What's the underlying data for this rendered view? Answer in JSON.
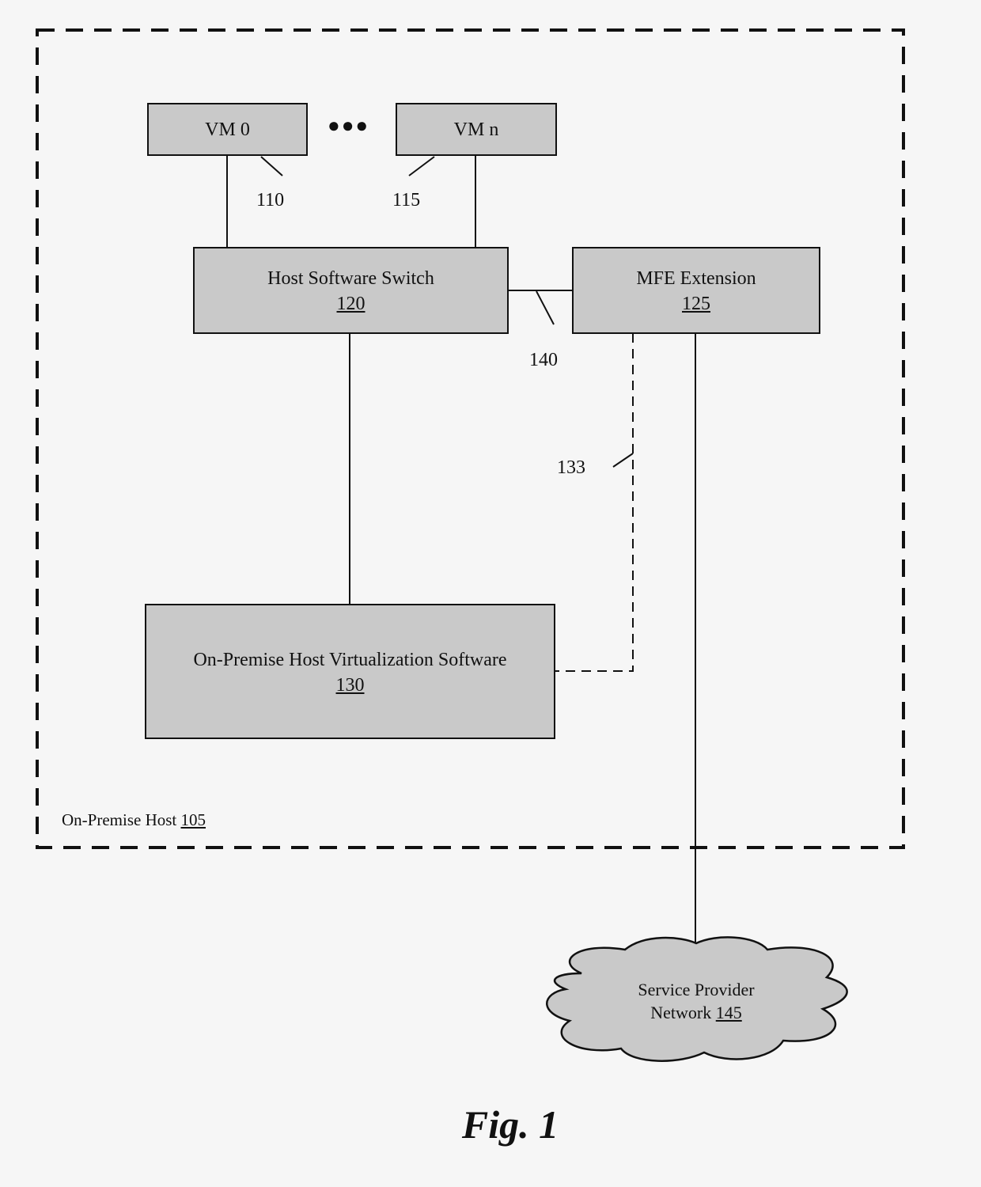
{
  "figure": {
    "caption": "Fig. 1",
    "container": {
      "label": "On-Premise Host",
      "ref": "105"
    },
    "nodes": {
      "vm0": {
        "label": "VM 0"
      },
      "ellipsis": "●●●",
      "vmn": {
        "label": "VM n"
      },
      "switch": {
        "label": "Host Software Switch",
        "ref": "120"
      },
      "mfe": {
        "label": "MFE Extension",
        "ref": "125"
      },
      "virt": {
        "label": "On-Premise Host Virtualization Software",
        "ref": "130"
      },
      "cloud": {
        "line1": "Service Provider",
        "line2": "Network",
        "ref": "145"
      }
    },
    "reference_labels": {
      "vm0_link": "110",
      "vmn_link": "115",
      "switch_mfe_link": "140",
      "mfe_virt_link": "133"
    },
    "edges": [
      {
        "from": "vm0",
        "to": "switch",
        "style": "solid",
        "ref": "110"
      },
      {
        "from": "vmn",
        "to": "switch",
        "style": "solid",
        "ref": "115"
      },
      {
        "from": "switch",
        "to": "mfe",
        "style": "solid",
        "ref": "140"
      },
      {
        "from": "switch",
        "to": "virt",
        "style": "solid"
      },
      {
        "from": "mfe",
        "to": "virt",
        "style": "dashed",
        "ref": "133"
      },
      {
        "from": "mfe",
        "to": "cloud",
        "style": "solid"
      }
    ]
  }
}
